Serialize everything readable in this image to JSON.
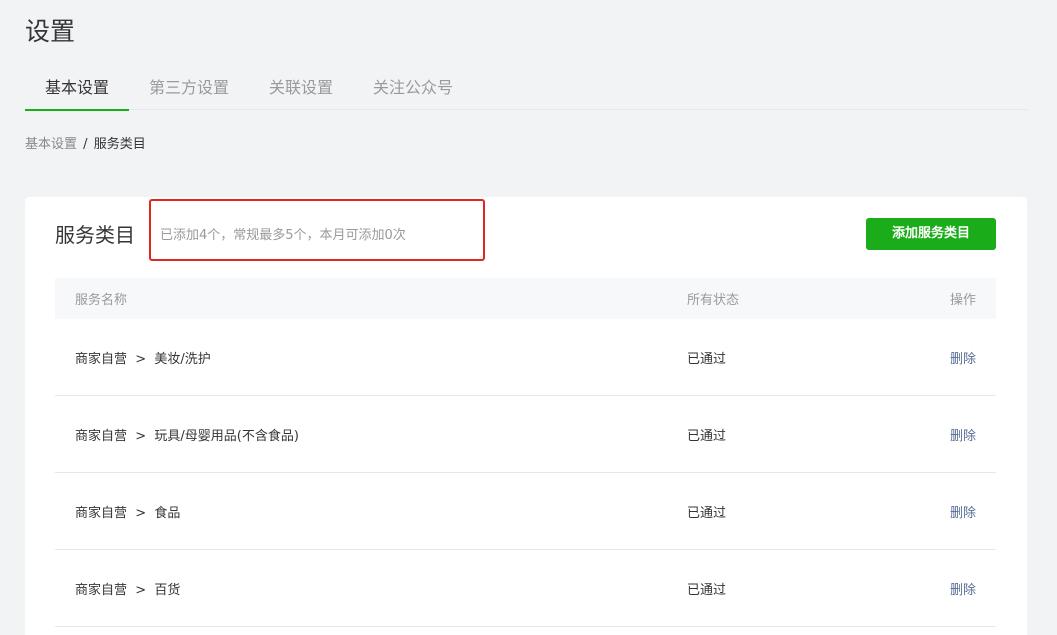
{
  "page": {
    "title": "设置"
  },
  "tabs": [
    {
      "label": "基本设置",
      "active": true
    },
    {
      "label": "第三方设置",
      "active": false
    },
    {
      "label": "关联设置",
      "active": false
    },
    {
      "label": "关注公众号",
      "active": false
    }
  ],
  "breadcrumb": {
    "parent": "基本设置",
    "separator": "/",
    "current": "服务类目"
  },
  "section": {
    "title": "服务类目",
    "tip": "已添加4个，常规最多5个，本月可添加0次",
    "add_button": "添加服务类目"
  },
  "table": {
    "headers": {
      "name": "服务名称",
      "status": "所有状态",
      "op": "操作"
    },
    "rows": [
      {
        "name": "商家自营  >  美妆/洗护",
        "status": "已通过",
        "op": "删除"
      },
      {
        "name": "商家自营  >  玩具/母婴用品(不含食品)",
        "status": "已通过",
        "op": "删除"
      },
      {
        "name": "商家自营  >  食品",
        "status": "已通过",
        "op": "删除"
      },
      {
        "name": "商家自营  >  百货",
        "status": "已通过",
        "op": "删除"
      }
    ]
  },
  "colors": {
    "accent": "#1aad19",
    "link": "#576b95",
    "highlight": "#e3251e"
  }
}
